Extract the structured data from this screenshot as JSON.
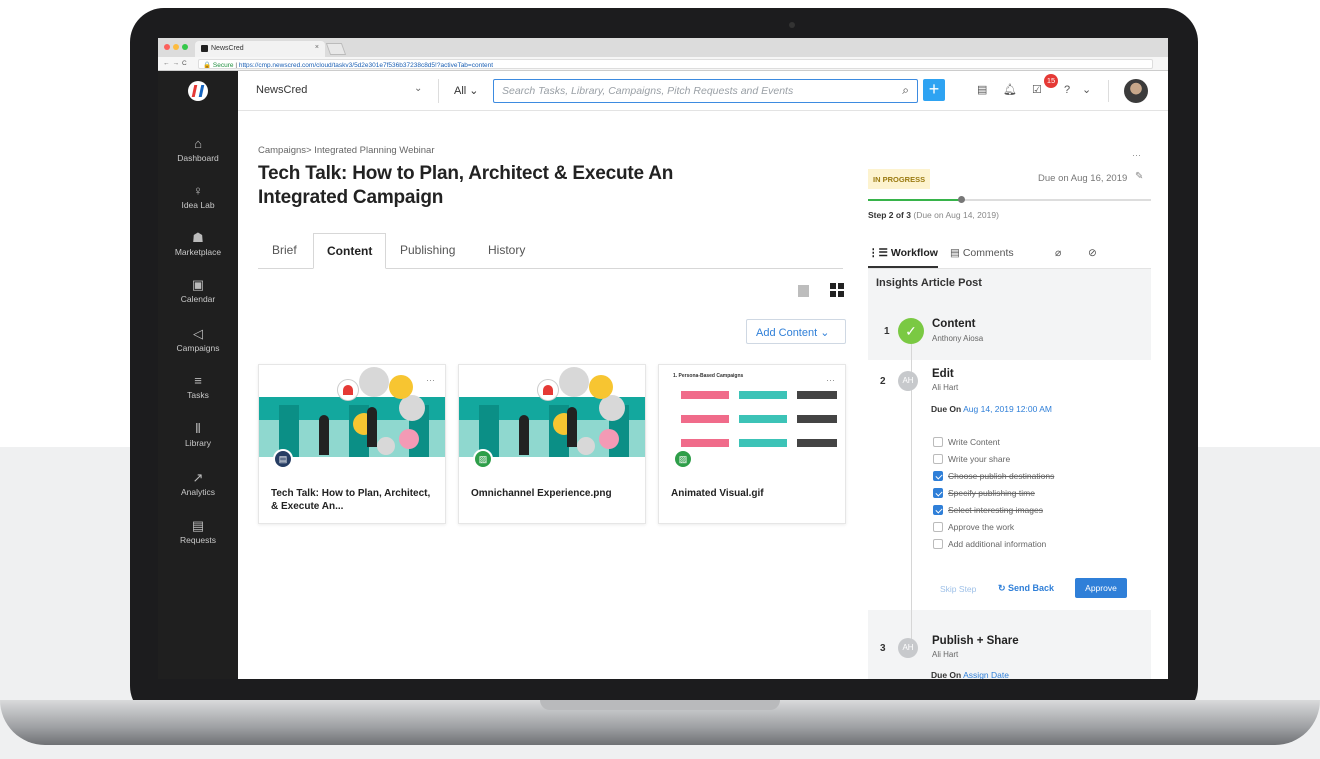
{
  "browser": {
    "tab_title": "NewsCred",
    "secure_label": "Secure",
    "url": "https://cmp.newscred.com/cloud/taskv3/5d2e301e7f536b37238c8d5!?activeTab=content"
  },
  "header": {
    "workspace": "NewsCred",
    "scope": "All",
    "search_placeholder": "Search Tasks, Library, Campaigns, Pitch Requests and Events",
    "notifications_count": "15"
  },
  "sidebar": {
    "items": [
      {
        "label": "Dashboard",
        "icon": "home-icon"
      },
      {
        "label": "Idea Lab",
        "icon": "lightbulb-icon"
      },
      {
        "label": "Marketplace",
        "icon": "store-icon"
      },
      {
        "label": "Calendar",
        "icon": "calendar-icon"
      },
      {
        "label": "Campaigns",
        "icon": "megaphone-icon"
      },
      {
        "label": "Tasks",
        "icon": "list-icon"
      },
      {
        "label": "Library",
        "icon": "library-icon"
      },
      {
        "label": "Analytics",
        "icon": "trend-icon"
      },
      {
        "label": "Requests",
        "icon": "document-icon"
      }
    ]
  },
  "main": {
    "breadcrumb": "Campaigns> Integrated Planning Webinar",
    "title": "Tech Talk: How to Plan, Architect & Execute An Integrated Campaign",
    "tabs": [
      "Brief",
      "Content",
      "Publishing",
      "History"
    ],
    "active_tab": "Content",
    "add_content_label": "Add Content",
    "cards": [
      {
        "name": "Tech Talk: How to Plan, Architect, & Execute An...",
        "type_icon": "document-icon",
        "type_color": "#263d63"
      },
      {
        "name": "Omnichannel Experience.png",
        "type_icon": "image-icon",
        "type_color": "#2e9e49"
      },
      {
        "name": "Animated Visual.gif",
        "type_icon": "image-icon",
        "type_color": "#2e9e49",
        "preview_title": "1. Persona-Based Campaigns"
      }
    ]
  },
  "panel": {
    "status": "IN PROGRESS",
    "due": "Due on Aug 16, 2019",
    "progress_fraction": 0.33,
    "step_label": "Step 2 of 3",
    "step_due": "(Due on Aug 14, 2019)",
    "tabs": {
      "workflow": "Workflow",
      "comments": "Comments"
    },
    "workflow_title": "Insights Article Post",
    "steps": [
      {
        "num": "1",
        "name": "Content",
        "owner": "Anthony Aiosa",
        "status": "done"
      },
      {
        "num": "2",
        "name": "Edit",
        "owner": "Ali Hart",
        "initials": "AH",
        "due_prefix": "Due On",
        "due_value": "Aug 14, 2019 12:00 AM"
      },
      {
        "num": "3",
        "name": "Publish + Share",
        "owner": "Ali Hart",
        "initials": "AH",
        "due_prefix": "Due On",
        "due_value": "Assign Date"
      }
    ],
    "checklist": [
      {
        "label": "Write Content",
        "checked": false
      },
      {
        "label": "Write your share",
        "checked": false
      },
      {
        "label": "Choose publish destinations",
        "checked": true
      },
      {
        "label": "Specify publishing time",
        "checked": true
      },
      {
        "label": "Select interesting images",
        "checked": true
      },
      {
        "label": "Approve the work",
        "checked": false
      },
      {
        "label": "Add additional information",
        "checked": false
      }
    ],
    "actions": {
      "skip": "Skip Step",
      "send_back": "Send Back",
      "approve": "Approve"
    }
  },
  "colors": {
    "accent": "#2f7fd8",
    "sidebar": "#1f1f1f",
    "success": "#7ac943",
    "status_bg": "#fdf3cf"
  }
}
